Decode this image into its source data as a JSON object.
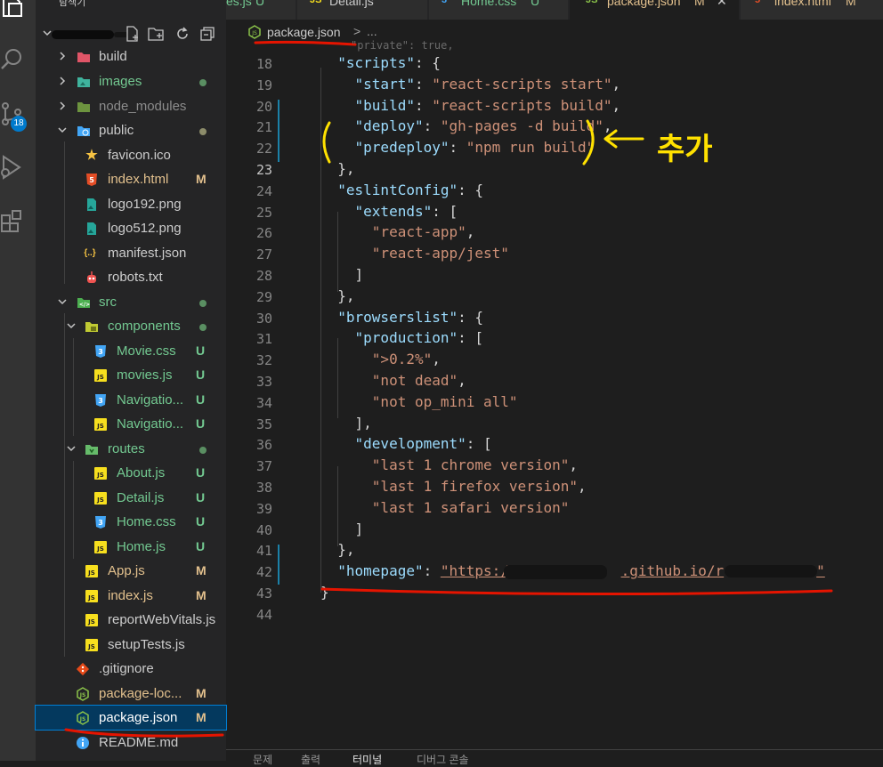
{
  "explorer": {
    "title": "탐색기",
    "items": [
      {
        "name": "build",
        "status": "",
        "dot": false
      },
      {
        "name": "images",
        "status": "",
        "dot": true
      },
      {
        "name": "node_modules",
        "status": "",
        "dot": false
      },
      {
        "name": "public",
        "status": "",
        "dot": true
      },
      {
        "name": "favicon.ico",
        "status": "",
        "dot": false
      },
      {
        "name": "index.html",
        "status": "M",
        "dot": false
      },
      {
        "name": "logo192.png",
        "status": "",
        "dot": false
      },
      {
        "name": "logo512.png",
        "status": "",
        "dot": false
      },
      {
        "name": "manifest.json",
        "status": "",
        "dot": false
      },
      {
        "name": "robots.txt",
        "status": "",
        "dot": false
      },
      {
        "name": "src",
        "status": "",
        "dot": true
      },
      {
        "name": "components",
        "status": "",
        "dot": true
      },
      {
        "name": "Movie.css",
        "status": "U",
        "dot": false
      },
      {
        "name": "movies.js",
        "status": "U",
        "dot": false
      },
      {
        "name": "Navigatio...",
        "status": "U",
        "dot": false
      },
      {
        "name": "Navigatio...",
        "status": "U",
        "dot": false
      },
      {
        "name": "routes",
        "status": "",
        "dot": true
      },
      {
        "name": "About.js",
        "status": "U",
        "dot": false
      },
      {
        "name": "Detail.js",
        "status": "U",
        "dot": false
      },
      {
        "name": "Home.css",
        "status": "U",
        "dot": false
      },
      {
        "name": "Home.js",
        "status": "U",
        "dot": false
      },
      {
        "name": "App.js",
        "status": "M",
        "dot": false
      },
      {
        "name": "index.js",
        "status": "M",
        "dot": false
      },
      {
        "name": "reportWebVitals.js",
        "status": "",
        "dot": false
      },
      {
        "name": "setupTests.js",
        "status": "",
        "dot": false
      },
      {
        "name": ".gitignore",
        "status": "",
        "dot": false
      },
      {
        "name": "package-loc...",
        "status": "M",
        "dot": false
      },
      {
        "name": "package.json",
        "status": "M",
        "dot": false
      },
      {
        "name": "README.md",
        "status": "",
        "dot": false
      }
    ]
  },
  "activity": {
    "badge": "18"
  },
  "tabs": [
    {
      "label": "es.js",
      "status": "U",
      "icon": ""
    },
    {
      "label": "Detail.js",
      "status": "",
      "icon": "JS"
    },
    {
      "label": "Home.css",
      "status": "U",
      "icon": "3"
    },
    {
      "label": "package.json",
      "status": "M",
      "icon": "JS"
    },
    {
      "label": "index.html",
      "status": "M",
      "icon": "5"
    }
  ],
  "breadcrumb": {
    "file": "package.json",
    "sep": ">",
    "more": "..."
  },
  "editor": {
    "top_fragment": "\"private\": true,",
    "lines": [
      {
        "n": "18",
        "parts": [
          [
            "p",
            "  "
          ],
          [
            "k",
            "\"scripts\""
          ],
          [
            "p",
            ": {"
          ]
        ]
      },
      {
        "n": "19",
        "parts": [
          [
            "p",
            "    "
          ],
          [
            "k",
            "\"start\""
          ],
          [
            "p",
            ": "
          ],
          [
            "s",
            "\"react-scripts start\""
          ],
          [
            "p",
            ","
          ]
        ]
      },
      {
        "n": "20",
        "parts": [
          [
            "p",
            "    "
          ],
          [
            "k",
            "\"build\""
          ],
          [
            "p",
            ": "
          ],
          [
            "s",
            "\"react-scripts build\""
          ],
          [
            "p",
            ","
          ]
        ]
      },
      {
        "n": "21",
        "parts": [
          [
            "p",
            "    "
          ],
          [
            "k",
            "\"deploy\""
          ],
          [
            "p",
            ": "
          ],
          [
            "s",
            "\"gh-pages -d build\""
          ],
          [
            "p",
            ","
          ]
        ]
      },
      {
        "n": "22",
        "parts": [
          [
            "p",
            "    "
          ],
          [
            "k",
            "\"predeploy\""
          ],
          [
            "p",
            ": "
          ],
          [
            "s",
            "\"npm run build\""
          ]
        ]
      },
      {
        "n": "23",
        "parts": [
          [
            "p",
            "  },"
          ]
        ]
      },
      {
        "n": "24",
        "parts": [
          [
            "p",
            "  "
          ],
          [
            "k",
            "\"eslintConfig\""
          ],
          [
            "p",
            ": {"
          ]
        ]
      },
      {
        "n": "25",
        "parts": [
          [
            "p",
            "    "
          ],
          [
            "k",
            "\"extends\""
          ],
          [
            "p",
            ": ["
          ]
        ]
      },
      {
        "n": "26",
        "parts": [
          [
            "p",
            "      "
          ],
          [
            "s",
            "\"react-app\""
          ],
          [
            "p",
            ","
          ]
        ]
      },
      {
        "n": "27",
        "parts": [
          [
            "p",
            "      "
          ],
          [
            "s",
            "\"react-app/jest\""
          ]
        ]
      },
      {
        "n": "28",
        "parts": [
          [
            "p",
            "    ]"
          ]
        ]
      },
      {
        "n": "29",
        "parts": [
          [
            "p",
            "  },"
          ]
        ]
      },
      {
        "n": "30",
        "parts": [
          [
            "p",
            "  "
          ],
          [
            "k",
            "\"browserslist\""
          ],
          [
            "p",
            ": {"
          ]
        ]
      },
      {
        "n": "31",
        "parts": [
          [
            "p",
            "    "
          ],
          [
            "k",
            "\"production\""
          ],
          [
            "p",
            ": ["
          ]
        ]
      },
      {
        "n": "32",
        "parts": [
          [
            "p",
            "      "
          ],
          [
            "s",
            "\">0.2%\""
          ],
          [
            "p",
            ","
          ]
        ]
      },
      {
        "n": "33",
        "parts": [
          [
            "p",
            "      "
          ],
          [
            "s",
            "\"not dead\""
          ],
          [
            "p",
            ","
          ]
        ]
      },
      {
        "n": "34",
        "parts": [
          [
            "p",
            "      "
          ],
          [
            "s",
            "\"not op_mini all\""
          ]
        ]
      },
      {
        "n": "35",
        "parts": [
          [
            "p",
            "    ],"
          ]
        ]
      },
      {
        "n": "36",
        "parts": [
          [
            "p",
            "    "
          ],
          [
            "k",
            "\"development\""
          ],
          [
            "p",
            ": ["
          ]
        ]
      },
      {
        "n": "37",
        "parts": [
          [
            "p",
            "      "
          ],
          [
            "s",
            "\"last 1 chrome version\""
          ],
          [
            "p",
            ","
          ]
        ]
      },
      {
        "n": "38",
        "parts": [
          [
            "p",
            "      "
          ],
          [
            "s",
            "\"last 1 firefox version\""
          ],
          [
            "p",
            ","
          ]
        ]
      },
      {
        "n": "39",
        "parts": [
          [
            "p",
            "      "
          ],
          [
            "s",
            "\"last 1 safari version\""
          ]
        ]
      },
      {
        "n": "40",
        "parts": [
          [
            "p",
            "    ]"
          ]
        ]
      },
      {
        "n": "41",
        "parts": [
          [
            "p",
            "  },"
          ]
        ]
      },
      {
        "n": "42",
        "parts": [
          [
            "p",
            "  "
          ],
          [
            "k",
            "\"homepage\""
          ],
          [
            "p",
            ": "
          ],
          [
            "s",
            "\"https://"
          ],
          [
            "r",
            ""
          ],
          [
            "s",
            ".github.io/r"
          ],
          [
            "r2",
            ""
          ],
          [
            "s",
            "\""
          ]
        ]
      },
      {
        "n": "43",
        "parts": [
          [
            "p",
            "}"
          ]
        ]
      },
      {
        "n": "44",
        "parts": []
      }
    ]
  },
  "annotation": {
    "label": "추가"
  },
  "panel": {
    "tabs": [
      "문제",
      "출력",
      "터미널",
      "디버그 콘솔"
    ]
  },
  "colors": {
    "accent": "#007acc",
    "annotation": "#ffe100",
    "underline": "#e51400"
  }
}
